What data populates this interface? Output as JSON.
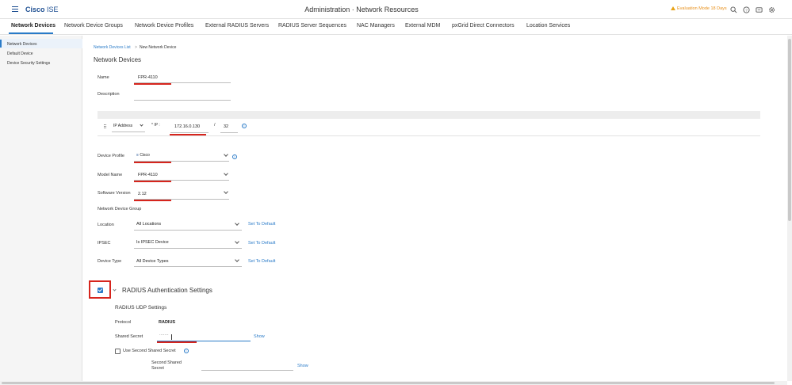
{
  "header": {
    "brand_bold": "Cisco",
    "brand_thin": "ISE",
    "title": "Administration · Network Resources",
    "evaluation": "Evaluation Mode 18 Days",
    "icons": [
      "search-icon",
      "help-icon",
      "notifications-icon",
      "settings-icon"
    ]
  },
  "tabs": [
    {
      "label": "Network Devices",
      "active": true
    },
    {
      "label": "Network Device Groups"
    },
    {
      "label": "Network Device Profiles"
    },
    {
      "label": "External RADIUS Servers"
    },
    {
      "label": "RADIUS Server Sequences"
    },
    {
      "label": "NAC Managers"
    },
    {
      "label": "External MDM"
    },
    {
      "label": "pxGrid Direct Connectors"
    },
    {
      "label": "Location Services"
    }
  ],
  "sidebar": {
    "items": [
      {
        "label": "Network Devices",
        "active": true
      },
      {
        "label": "Default Device"
      },
      {
        "label": "Device Security Settings"
      }
    ]
  },
  "breadcrumb": {
    "link": "Network Devices List",
    "separator": ">",
    "current": "New Network Device"
  },
  "page_title": "Network Devices",
  "form": {
    "name_label": "Name",
    "name_value": "FPR-4110",
    "description_label": "Description",
    "description_value": "",
    "ip_type": "IP Address",
    "ip_label": "* IP :",
    "ip_value": "172.16.0.130",
    "ip_slash": "/",
    "ip_mask": "32",
    "device_profile_label": "Device Profile",
    "device_profile_value": "Cisco",
    "model_name_label": "Model Name",
    "model_name_value": "FPR-4110",
    "software_version_label": "Software Version",
    "software_version_value": "2.12",
    "ndg_label": "Network Device Group",
    "location_label": "Location",
    "location_value": "All Locations",
    "ipsec_label": "IPSEC",
    "ipsec_value": "Is IPSEC Device",
    "device_type_label": "Device Type",
    "device_type_value": "All Device Types",
    "set_default": "Set To Default"
  },
  "radius": {
    "section_title": "RADIUS Authentication Settings",
    "udp_title": "RADIUS UDP Settings",
    "protocol_label": "Protocol",
    "protocol_value": "RADIUS",
    "shared_secret_label": "Shared Secret",
    "shared_secret_value": "·······",
    "show_label": "Show",
    "use_second_label": "Use Second Shared Secret",
    "second_secret_label_1": "Second Shared",
    "second_secret_label_2": "Secret",
    "second_show_label": "Show"
  },
  "colors": {
    "brand": "#1e4f92",
    "accent": "#2a7bc8",
    "annotation_red": "#d6251d",
    "warning": "#e8901b"
  }
}
